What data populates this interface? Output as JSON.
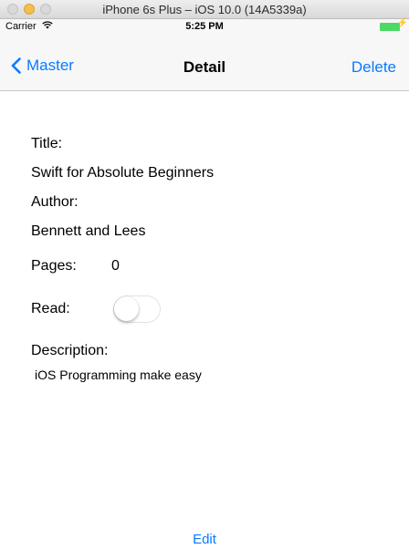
{
  "window": {
    "title": "iPhone 6s Plus – iOS 10.0 (14A5339a)"
  },
  "status_bar": {
    "carrier": "Carrier",
    "time": "5:25 PM"
  },
  "nav": {
    "back_label": "Master",
    "title": "Detail",
    "delete_label": "Delete"
  },
  "detail": {
    "title_label": "Title:",
    "title_value": "Swift for Absolute Beginners",
    "author_label": "Author:",
    "author_value": "Bennett and Lees",
    "pages_label": "Pages:",
    "pages_value": "0",
    "read_label": "Read:",
    "read_on": false,
    "description_label": "Description:",
    "description_value": "iOS Programming make easy"
  },
  "toolbar": {
    "edit_label": "Edit"
  },
  "colors": {
    "accent": "#0a7aff",
    "battery": "#4cd964"
  },
  "icons": [
    "back-chevron-icon",
    "wifi-icon",
    "battery-icon",
    "bolt-icon"
  ]
}
